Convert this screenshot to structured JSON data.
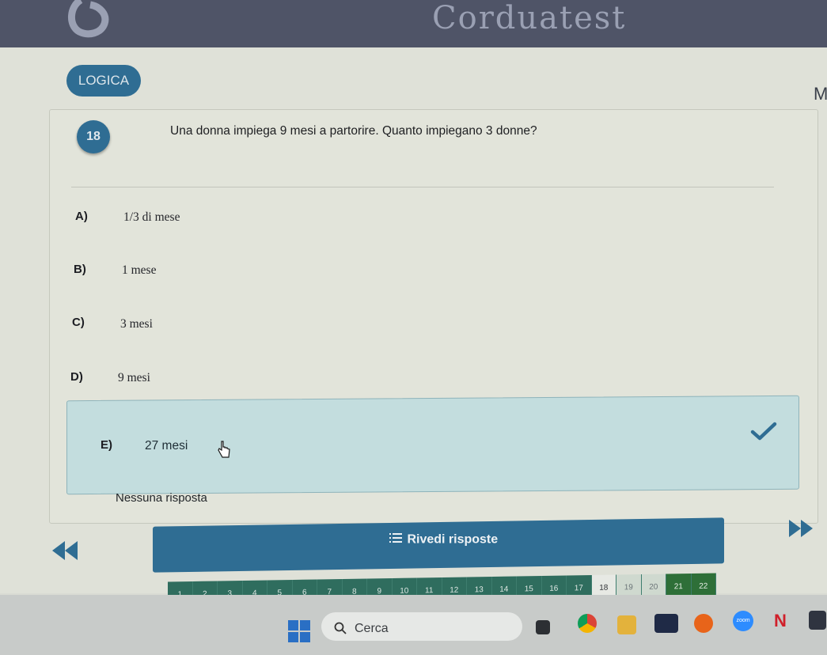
{
  "header": {
    "brand": "Corduatest"
  },
  "subject": {
    "label": "LOGICA"
  },
  "edge_letter": "M",
  "question": {
    "number": "18",
    "text": "Una donna impiega 9 mesi a partorire. Quanto impiegano 3 donne?"
  },
  "options": [
    {
      "letter": "A)",
      "text": "1/3 di mese"
    },
    {
      "letter": "B)",
      "text": "1 mese"
    },
    {
      "letter": "C)",
      "text": "3 mesi"
    },
    {
      "letter": "D)",
      "text": "9 mesi"
    },
    {
      "letter": "E)",
      "text": "27 mesi"
    }
  ],
  "selected_option": "E",
  "no_answer_label": "Nessuna risposta",
  "review_button": {
    "label": "Rivedi risposte"
  },
  "question_nav": [
    "1",
    "2",
    "3",
    "4",
    "5",
    "6",
    "7",
    "8",
    "9",
    "10",
    "11",
    "12",
    "13",
    "14",
    "15",
    "16",
    "17",
    "18",
    "19",
    "20",
    "21",
    "22"
  ],
  "current_question": "18",
  "taskbar": {
    "search_placeholder": "Cerca",
    "zoom_label": "zoom"
  },
  "colors": {
    "accent": "#2f6d93",
    "selected_bg": "#c3ddde",
    "nav_answered": "#2f6d5e",
    "nav_green": "#2e6f38"
  }
}
